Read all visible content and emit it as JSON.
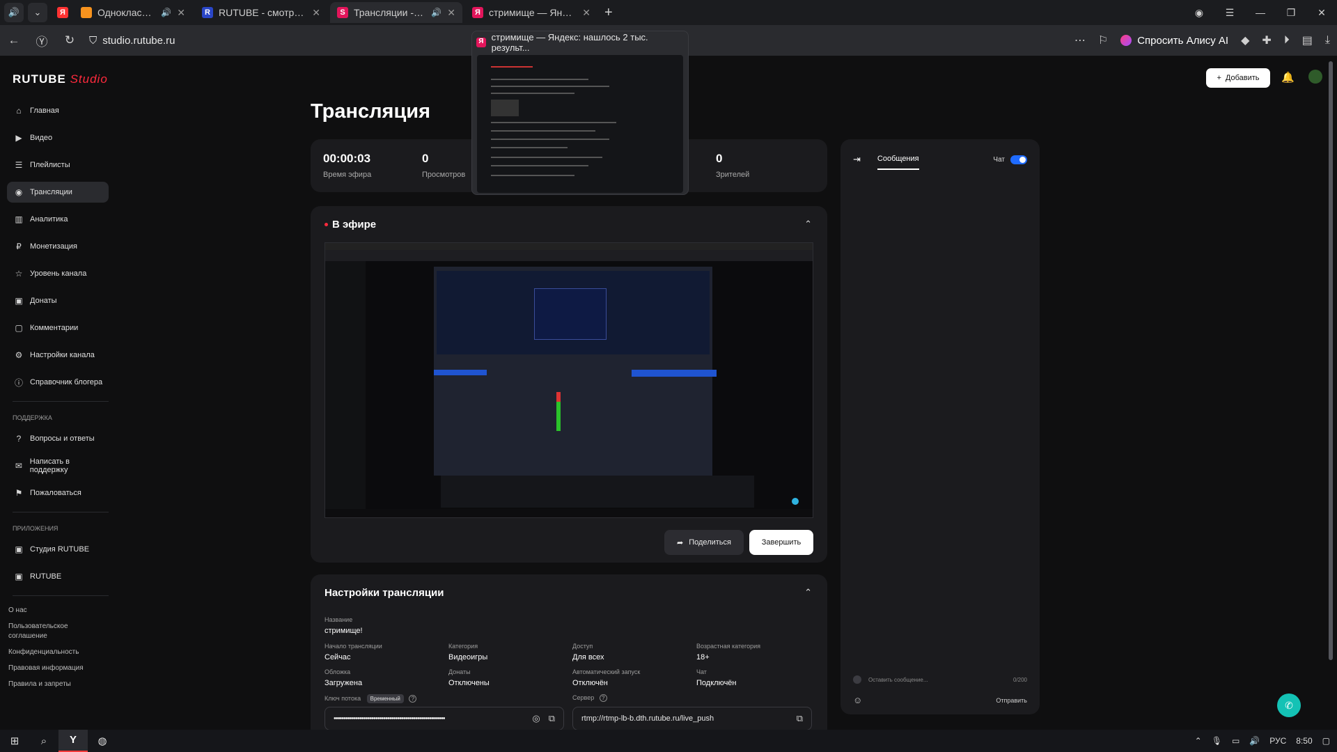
{
  "browser": {
    "tabs": [
      {
        "favicon": "Я",
        "fav_color": "#f33",
        "title": "",
        "closable": false
      },
      {
        "favicon": "ок-icon",
        "fav_color": "#f7931e",
        "title": "Одноклассники",
        "sound": "🔊",
        "close": "✕"
      },
      {
        "favicon": "R",
        "fav_color": "#2a46c8",
        "title": "RUTUBE - смотрите виде",
        "close": "✕"
      },
      {
        "favicon": "S",
        "fav_color": "#e3155b",
        "title": "Трансляции - Студ",
        "sound": "🔊",
        "close": "✕",
        "active": true
      },
      {
        "favicon": "Я",
        "fav_color": "#e3155b",
        "title": "стримище — Яндекс:",
        "close": "✕"
      }
    ],
    "new_tab": "+",
    "url": "studio.rutube.ru",
    "alice_label": "Спросить Алису AI",
    "preview_title": "стримище — Яндекс: нашлось 2 тыс. результ..."
  },
  "app": {
    "logo_main": "RUTUBE",
    "logo_sub": "Studio",
    "add_button": "Добавить"
  },
  "sidebar": {
    "items": [
      {
        "icon": "home-icon",
        "glyph": "⌂",
        "label": "Главная"
      },
      {
        "icon": "video-icon",
        "glyph": "▶",
        "label": "Видео"
      },
      {
        "icon": "playlist-icon",
        "glyph": "☰",
        "label": "Плейлисты"
      },
      {
        "icon": "broadcast-icon",
        "glyph": "◉",
        "label": "Трансляции",
        "active": true
      },
      {
        "icon": "analytics-icon",
        "glyph": "▥",
        "label": "Аналитика"
      },
      {
        "icon": "monetization-icon",
        "glyph": "₽",
        "label": "Монетизация"
      },
      {
        "icon": "star-icon",
        "glyph": "☆",
        "label": "Уровень канала"
      },
      {
        "icon": "donate-icon",
        "glyph": "▣",
        "label": "Донаты"
      },
      {
        "icon": "comment-icon",
        "glyph": "▢",
        "label": "Комментарии"
      },
      {
        "icon": "gear-icon",
        "glyph": "⚙",
        "label": "Настройки канала"
      },
      {
        "icon": "info-icon",
        "glyph": "ⓘ",
        "label": "Справочник блогера"
      }
    ],
    "support_title": "ПОДДЕРЖКА",
    "support": [
      {
        "icon": "question-icon",
        "glyph": "?",
        "label": "Вопросы и ответы"
      },
      {
        "icon": "mail-icon",
        "glyph": "✉",
        "label": "Написать в поддержку"
      },
      {
        "icon": "flag-icon",
        "glyph": "⚑",
        "label": "Пожаловаться"
      }
    ],
    "apps_title": "ПРИЛОЖЕНИЯ",
    "apps": [
      {
        "icon": "studio-icon",
        "glyph": "▣",
        "label": "Студия RUTUBE"
      },
      {
        "icon": "rutube-icon",
        "glyph": "▣",
        "label": "RUTUBE"
      }
    ],
    "footer": [
      "О нас",
      "Пользовательское соглашение",
      "Конфиденциальность",
      "Правовая информация",
      "Правила и запреты"
    ]
  },
  "main": {
    "title": "Трансляция",
    "stats": [
      {
        "value": "00:00:03",
        "label": "Время эфира"
      },
      {
        "value": "0",
        "label": "Просмотров"
      },
      {
        "value": "0",
        "label": "Зрителей"
      }
    ],
    "live_title": "В эфире",
    "share_button": "Поделиться",
    "end_button": "Завершить",
    "settings_title": "Настройки трансляции",
    "settings": {
      "name_label": "Название",
      "name": "стримище!",
      "start_label": "Начало трансляции",
      "start": "Сейчас",
      "category_label": "Категория",
      "category": "Видеоигры",
      "access_label": "Доступ",
      "access": "Для всех",
      "age_label": "Возрастная категория",
      "age": "18+",
      "cover_label": "Обложка",
      "cover": "Загружена",
      "donates_label": "Донаты",
      "donates": "Отключены",
      "autostart_label": "Автоматический запуск",
      "autostart": "Отключён",
      "chat_label": "Чат",
      "chat": "Подключён",
      "key_label": "Ключ потока",
      "key_badge": "Временный",
      "key_value": "••••••••••••••••••••••••••••••••••••••••••••••••••••••••",
      "server_label": "Сервер",
      "server_value": "rtmp://rtmp-lb-b.dth.rutube.ru/live_push"
    }
  },
  "chat": {
    "tab": "Сообщения",
    "toggle_label": "Чат",
    "toggle_on": true,
    "placeholder": "Оставить сообщение...",
    "counter": "0/200",
    "send": "Отправить"
  },
  "taskbar": {
    "lang": "РУС",
    "time": "8:50"
  }
}
